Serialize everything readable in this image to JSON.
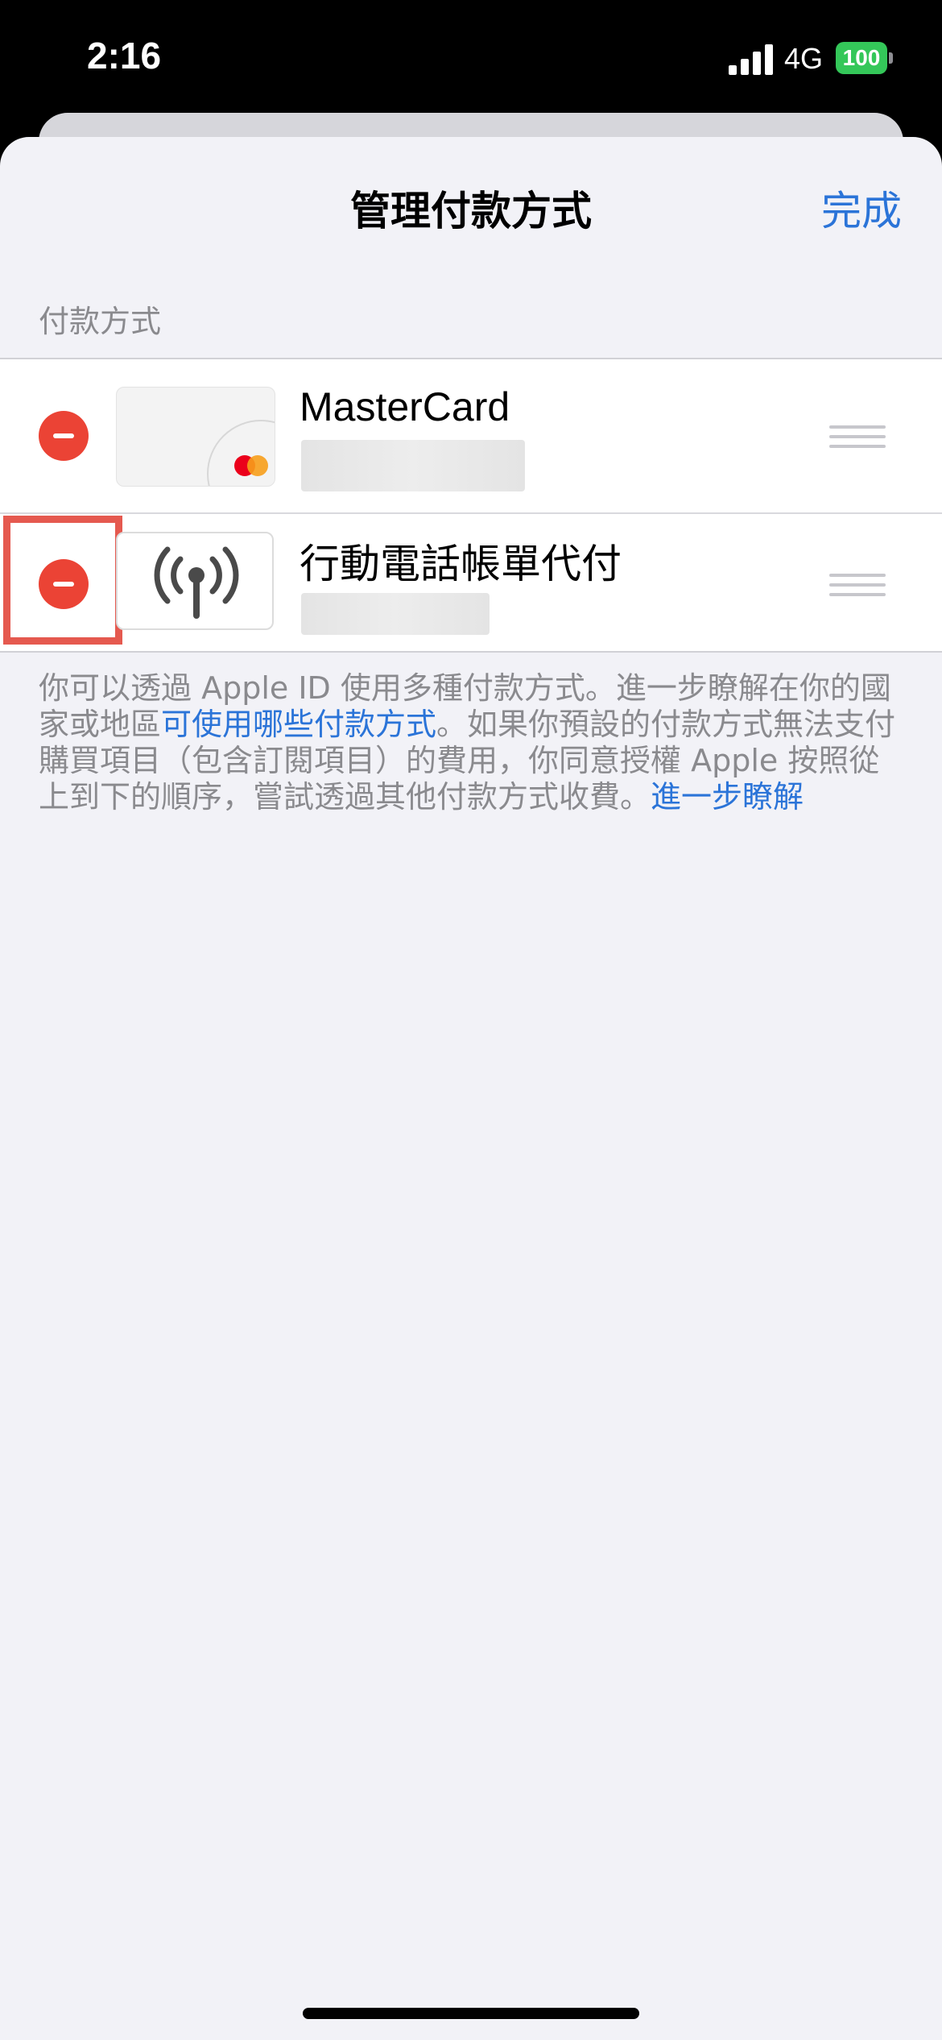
{
  "status_bar": {
    "time": "2:16",
    "network": "4G",
    "battery": "100",
    "battery_color": "#34c759",
    "signal_icon": "cellular-signal-icon"
  },
  "nav": {
    "title": "管理付款方式",
    "done_label": "完成"
  },
  "section_header": "付款方式",
  "payment_methods": [
    {
      "title": "MasterCard",
      "icon": "mastercard-card-icon"
    },
    {
      "title": "行動電話帳單代付",
      "icon": "antenna-icon"
    }
  ],
  "footer": {
    "text_1": "你可以透過 Apple ID 使用多種付款方式。進一步瞭解在你的國家或地區",
    "link_1": "可使用哪些付款方式",
    "text_2": "。如果你預設的付款方式無法支付購買項目（包含訂閱項目）的費用，你同意授權 Apple 按照從上到下的順序，嘗試透過其他付款方式收費。",
    "link_2": "進一步瞭解"
  },
  "colors": {
    "accent": "#2b74d8",
    "delete": "#eb4335",
    "highlight": "#e5594f",
    "background": "#f2f2f7"
  }
}
